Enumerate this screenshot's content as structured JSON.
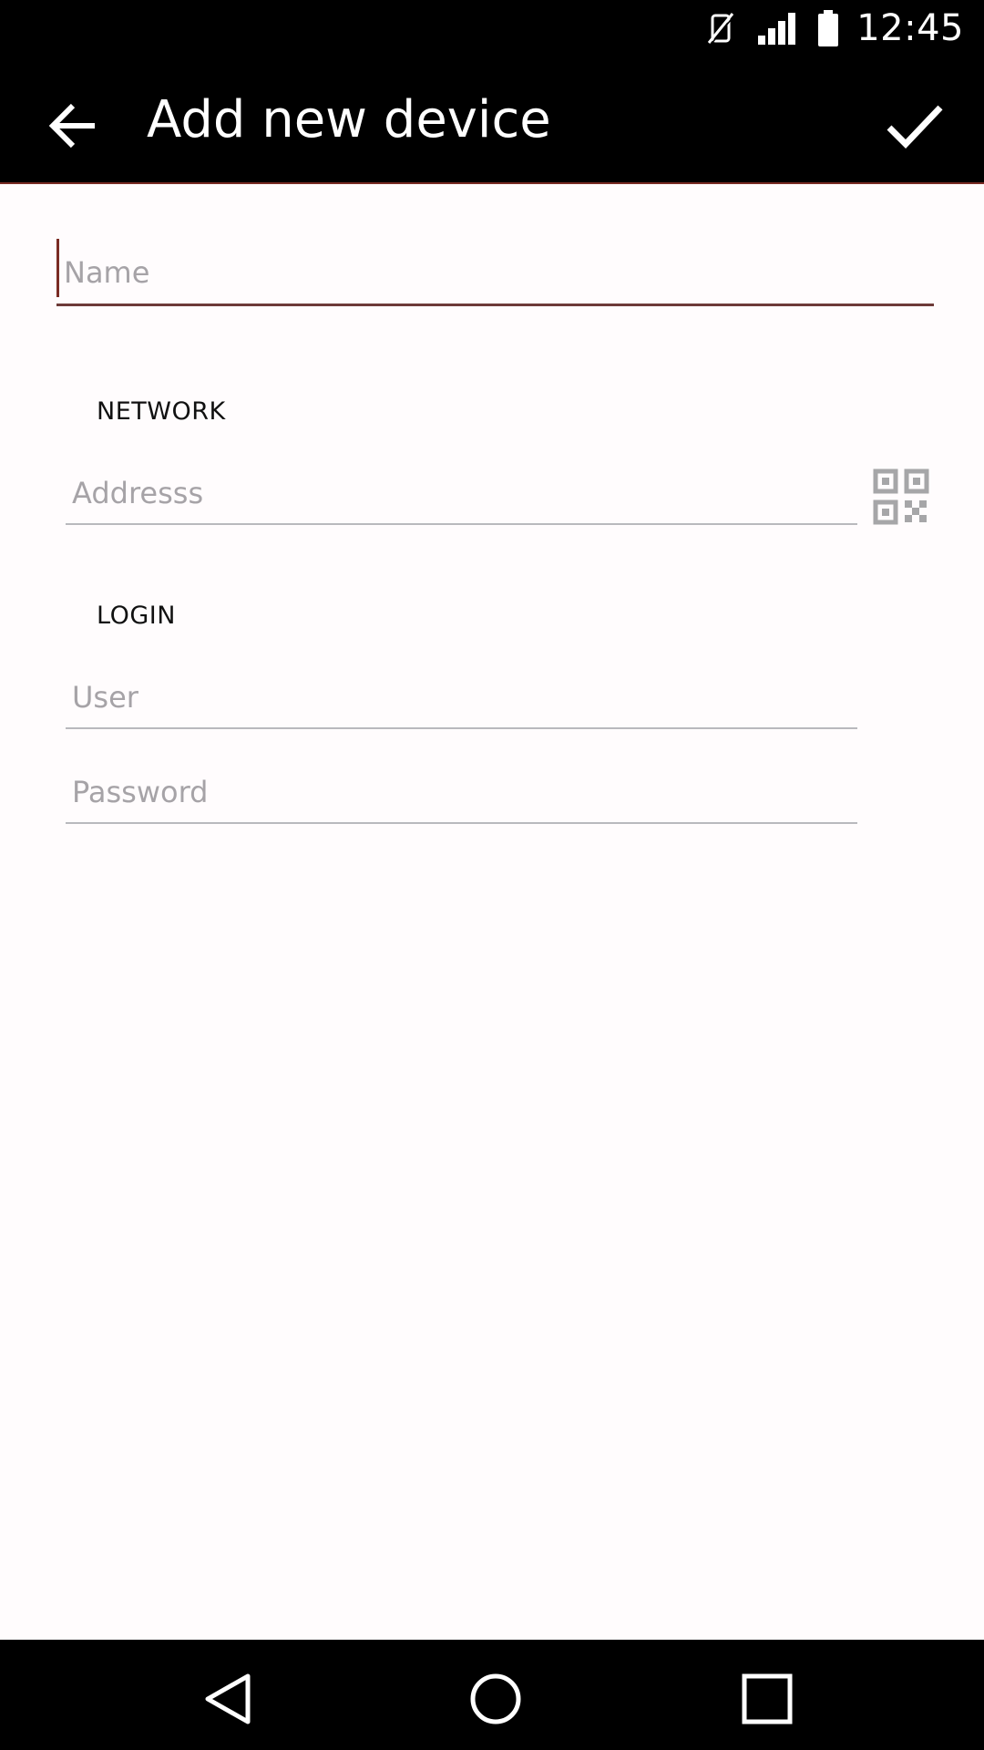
{
  "status_bar": {
    "time": "12:45",
    "icons": [
      "vibrate-off-icon",
      "signal-icon",
      "battery-icon"
    ]
  },
  "app_bar": {
    "title": "Add new device",
    "back_icon": "arrow-back-icon",
    "confirm_icon": "check-icon"
  },
  "form": {
    "name_placeholder": "Name",
    "network_section": "NETWORK",
    "address_placeholder": "Addresss",
    "qr_icon": "qr-code-icon",
    "login_section": "LOGIN",
    "user_placeholder": "User",
    "password_placeholder": "Password"
  },
  "nav_bar": {
    "back": "nav-back-icon",
    "home": "nav-home-icon",
    "recents": "nav-recents-icon"
  },
  "colors": {
    "bar_background": "#000000",
    "page_background": "#fffcfd",
    "accent": "#7a2b24",
    "placeholder": "#a6a3a7"
  }
}
